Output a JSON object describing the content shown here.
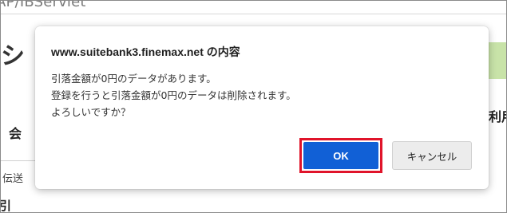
{
  "background": {
    "url_fragment": "AP/IBServlet",
    "brand_fragment": "シ",
    "section_heading_fragment": "会",
    "right_label_fragment": "利用",
    "tab_fragment": "伝送",
    "bottom_fragment": "引"
  },
  "dialog": {
    "title": "www.suitebank3.finemax.net の内容",
    "message_lines": [
      "引落金額が0円のデータがあります。",
      "登録を行うと引落金額が0円のデータは削除されます。",
      "よろしいですか？"
    ],
    "ok_label": "OK",
    "cancel_label": "キャンセル"
  },
  "colors": {
    "ok_button": "#1160d6",
    "highlight": "#e0142a",
    "cancel_button": "#ececec"
  }
}
